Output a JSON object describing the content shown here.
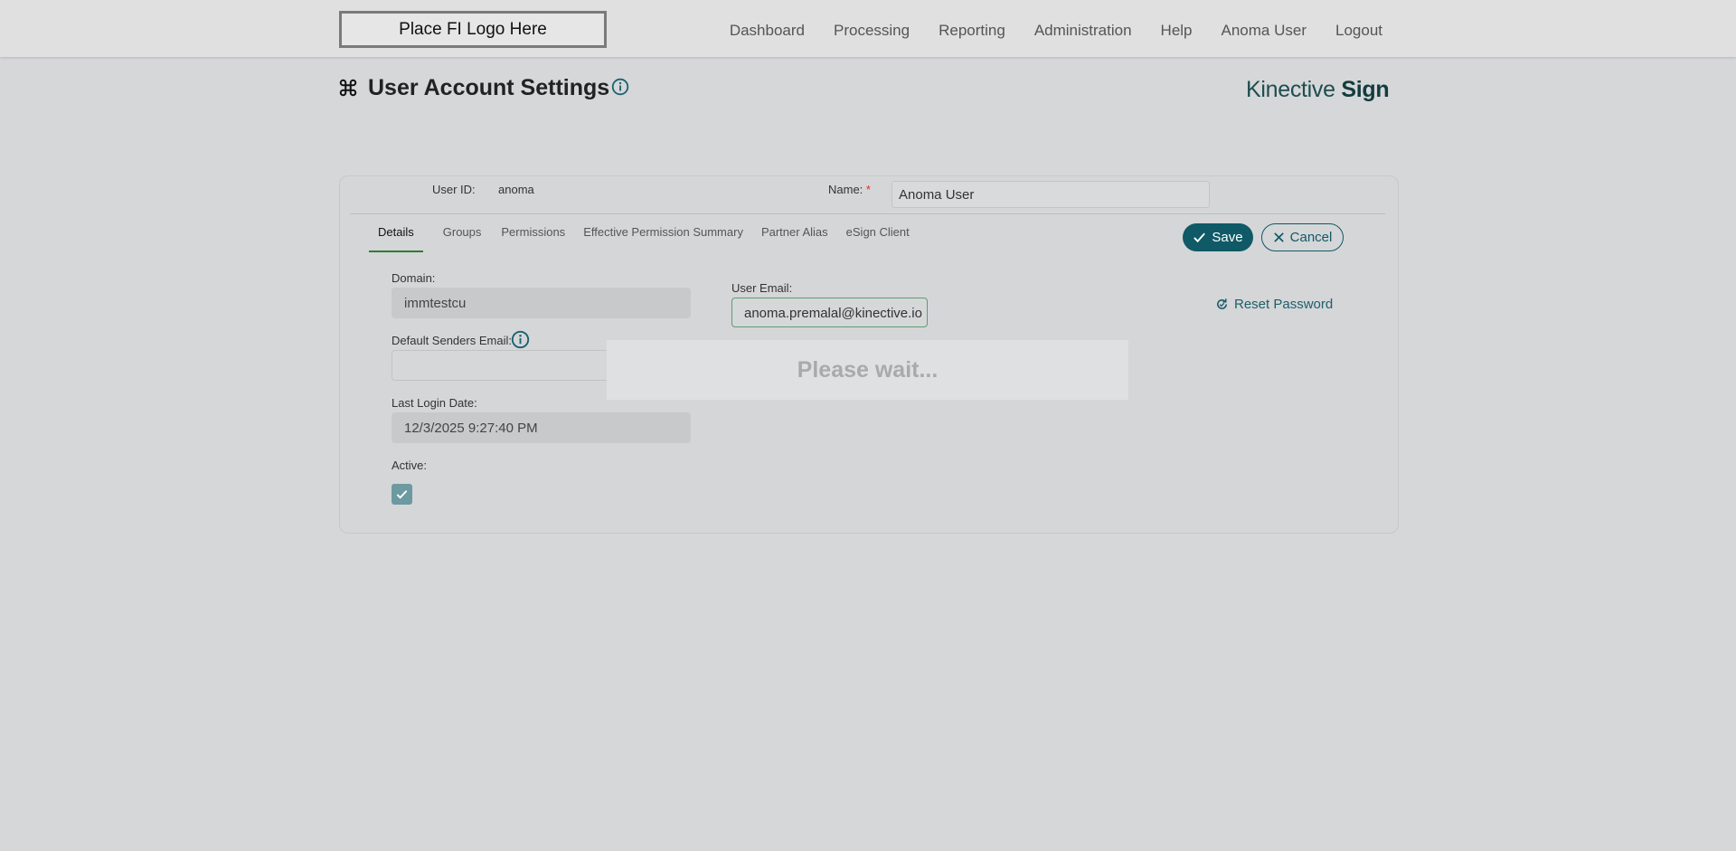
{
  "header": {
    "logo_text": "Place FI Logo Here",
    "nav": [
      "Dashboard",
      "Processing",
      "Reporting",
      "Administration",
      "Help",
      "Anoma User",
      "Logout"
    ]
  },
  "page": {
    "title": "User Account Settings",
    "brand_light": "Kinective",
    "brand_bold": "Sign"
  },
  "user": {
    "user_id_label": "User ID:",
    "user_id": "anoma",
    "name_label": "Name:",
    "name_required": "*",
    "name_value": "Anoma User"
  },
  "tabs": [
    "Details",
    "Groups",
    "Permissions",
    "Effective Permission Summary",
    "Partner Alias",
    "eSign Client"
  ],
  "actions": {
    "save_label": "Save",
    "cancel_label": "Cancel",
    "reset_password_label": "Reset Password"
  },
  "details": {
    "domain_label": "Domain:",
    "domain_value": "immtestcu",
    "user_email_label": "User Email:",
    "user_email_value": "anoma.premalal@kinective.io",
    "default_senders_label": "Default Senders Email:",
    "default_senders_value": "",
    "last_login_label": "Last Login Date:",
    "last_login_value": "12/3/2025 9:27:40 PM",
    "active_label": "Active:",
    "active_checked": true
  },
  "overlay": {
    "message": "Please wait..."
  },
  "colors": {
    "primary": "#0f5a66",
    "active_tab": "#2e7d32",
    "required": "#dd3322"
  }
}
